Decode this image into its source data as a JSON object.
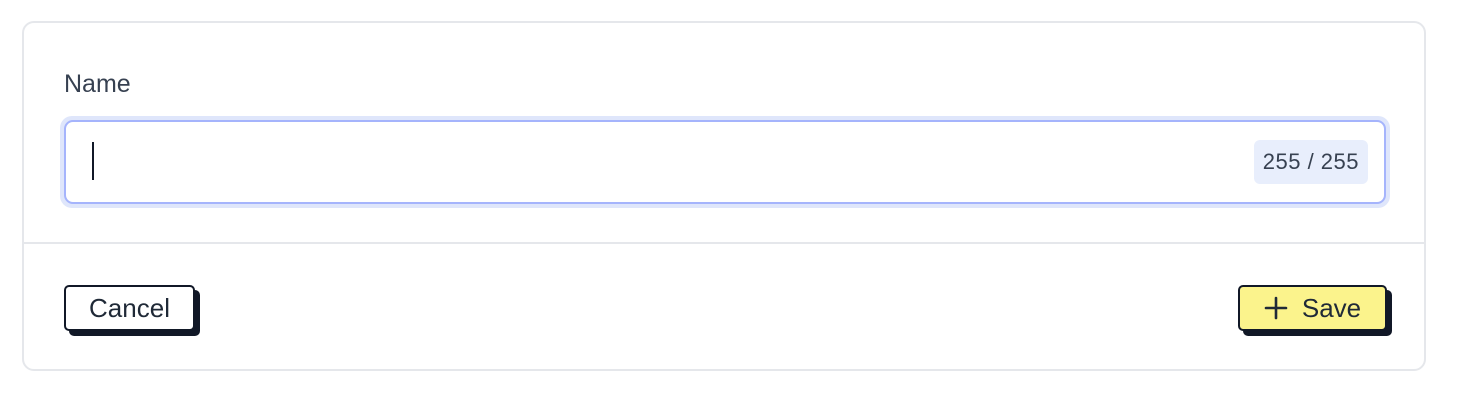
{
  "form": {
    "name_label": "Name",
    "name_value": "",
    "char_counter": "255 / 255"
  },
  "footer": {
    "cancel_label": "Cancel",
    "save_label": "Save",
    "save_icon": "plus-icon"
  },
  "colors": {
    "save_bg": "#fbf38c",
    "focus_ring": "#dfe6fb",
    "focus_border": "#a5b4fc",
    "counter_bg": "#e8eefc"
  }
}
